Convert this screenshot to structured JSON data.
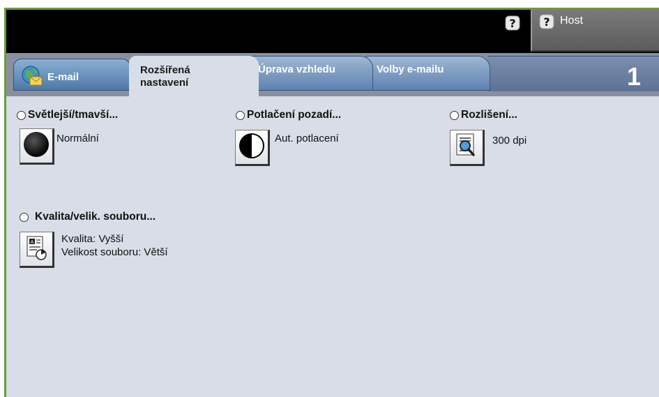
{
  "header": {
    "help_icon": "question-mark-icon",
    "host_label": "Host"
  },
  "tabs": [
    {
      "label": "E-mail",
      "icon": "globe-envelope-icon",
      "selected": false
    },
    {
      "label": "Rozšířená nastavení",
      "line1": "Rozšířená",
      "line2": "nastavení",
      "selected": true
    },
    {
      "label": "Úprava vzhledu",
      "selected": false
    },
    {
      "label": "Volby e-mailu",
      "selected": false
    }
  ],
  "job_count": "1",
  "features": {
    "lighten_darken": {
      "title": "Světlejší/tmavší...",
      "value": "Normální",
      "icon": "dark-circle-icon"
    },
    "background_suppression": {
      "title": "Potlačení pozadí...",
      "value": "Aut. potlacení",
      "icon": "half-circle-icon"
    },
    "resolution": {
      "title": "Rozlišení...",
      "value": "300 dpi",
      "icon": "magnifier-document-icon"
    },
    "quality_size": {
      "title": "Kvalita/velik. souboru...",
      "value_line1": "Kvalita: Vyšší",
      "value_line2": "Velikost souboru: Větší",
      "icon": "document-quality-icon"
    }
  }
}
